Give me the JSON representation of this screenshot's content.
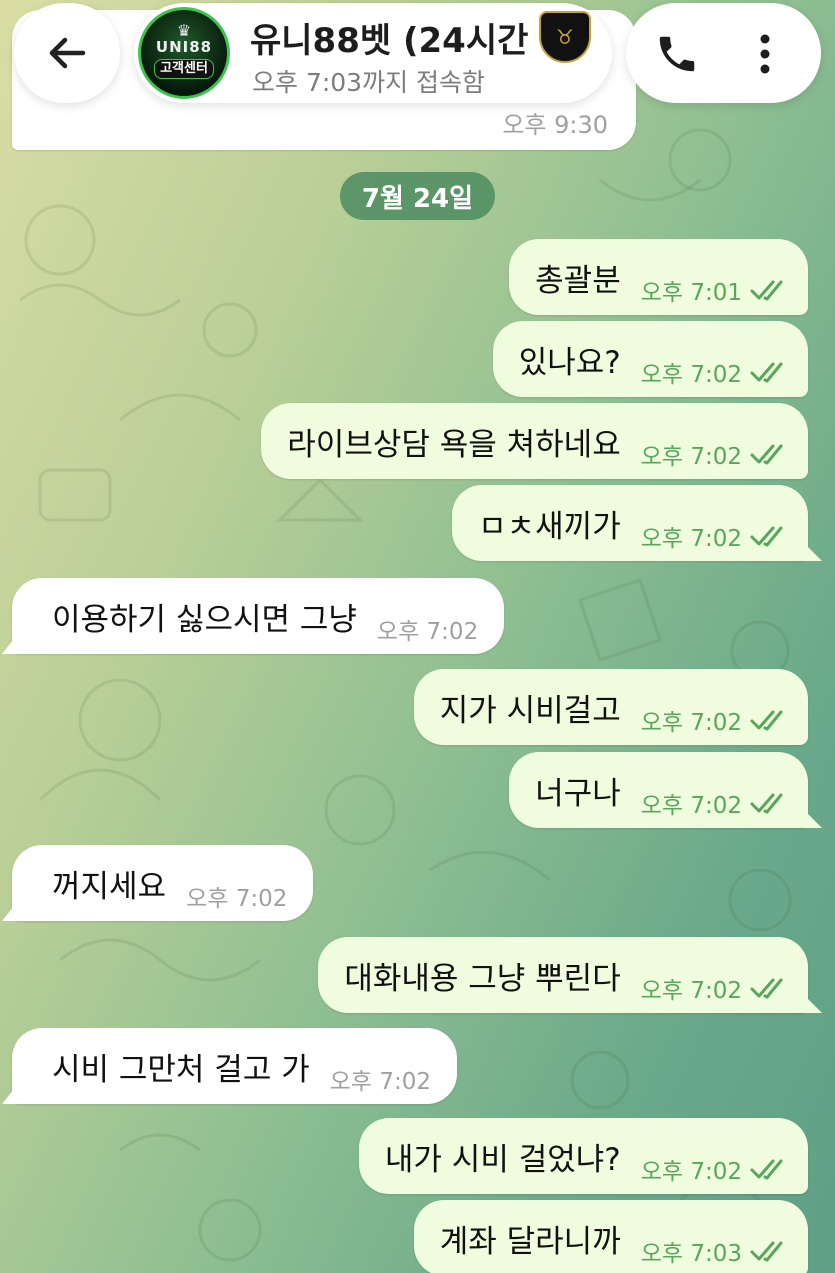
{
  "header": {
    "back_icon": "arrow-left-icon",
    "title": "유니88벳 (24시간",
    "status": "오후 7:03까지 접속함",
    "avatar": {
      "brand": "UNI88",
      "subtitle": "고객센터"
    },
    "call_icon": "phone-icon",
    "menu_icon": "more-vertical-icon"
  },
  "previous_message": {
    "time": "오후 9:30"
  },
  "date_divider": "7월 24일",
  "messages": [
    {
      "direction": "out",
      "text": "총괄분",
      "time": "오후 7:01",
      "read": true
    },
    {
      "direction": "out",
      "text": "있나요?",
      "time": "오후 7:02",
      "read": true
    },
    {
      "direction": "out",
      "text": "라이브상담 욕을 쳐하네요",
      "time": "오후 7:02",
      "read": true
    },
    {
      "direction": "out",
      "text": "ㅁㅊ새끼가",
      "time": "오후 7:02",
      "read": true
    },
    {
      "direction": "in",
      "text": "이용하기 싫으시면 그냥",
      "time": "오후 7:02"
    },
    {
      "direction": "out",
      "text": "지가 시비걸고",
      "time": "오후 7:02",
      "read": true
    },
    {
      "direction": "out",
      "text": "너구나",
      "time": "오후 7:02",
      "read": true
    },
    {
      "direction": "in",
      "text": "꺼지세요",
      "time": "오후 7:02"
    },
    {
      "direction": "out",
      "text": "대화내용 그냥 뿌린다",
      "time": "오후 7:02",
      "read": true
    },
    {
      "direction": "in",
      "text": "시비 그만처 걸고 가",
      "time": "오후 7:02"
    },
    {
      "direction": "out",
      "text": "내가 시비 걸었냐?",
      "time": "오후 7:02",
      "read": true
    },
    {
      "direction": "out",
      "text": "계좌 달라니까",
      "time": "오후 7:03",
      "read": true
    }
  ],
  "colors": {
    "outgoing_bubble": "#effdde",
    "incoming_bubble": "#ffffff",
    "outgoing_time": "#59a55b",
    "date_chip": "#4c8c60"
  }
}
